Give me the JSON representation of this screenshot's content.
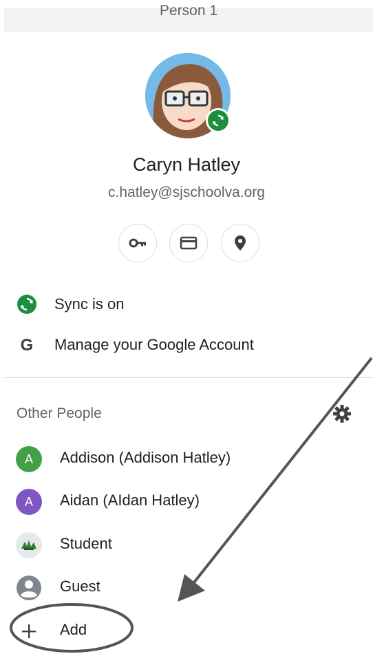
{
  "header": {
    "title": "Person 1"
  },
  "profile": {
    "name": "Caryn Hatley",
    "email": "c.hatley@sjschoolva.org"
  },
  "quick_actions": [
    {
      "icon": "key-icon"
    },
    {
      "icon": "credit-card-icon"
    },
    {
      "icon": "location-pin-icon"
    }
  ],
  "menu": {
    "sync_label": "Sync is on",
    "manage_label": "Manage your Google Account"
  },
  "other_people": {
    "section_label": "Other People",
    "people": [
      {
        "initial": "A",
        "label": "Addison (Addison Hatley)",
        "color": "#43a047"
      },
      {
        "initial": "A",
        "label": "Aidan (AIdan Hatley)",
        "color": "#7e57c2"
      },
      {
        "label": "Student"
      },
      {
        "label": "Guest"
      }
    ],
    "add_label": "Add"
  },
  "colors": {
    "sync_green": "#1e8e3e",
    "annotation": "#555555"
  }
}
